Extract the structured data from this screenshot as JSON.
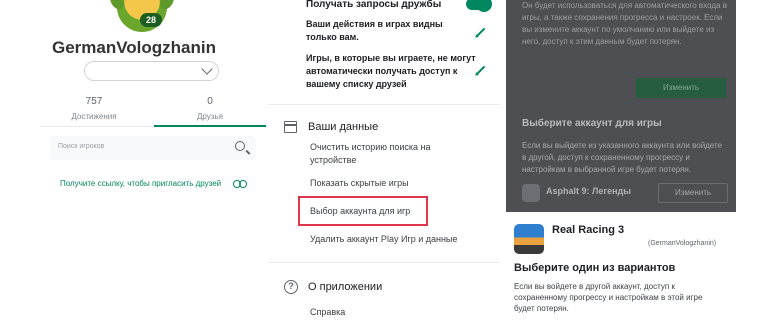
{
  "profile": {
    "level": "28",
    "username": "GermanVologzhanin",
    "stats": {
      "achievements_value": "757",
      "achievements_label": "Достижения",
      "friends_value": "0",
      "friends_label": "Друзья"
    },
    "search_placeholder": "Поиск игроков",
    "invite_text": "Получите ссылку, чтобы пригласить друзей"
  },
  "settings": {
    "friend_requests_title": "Получать запросы дружбы",
    "game_activity_text": "Ваши действия в играх видны только вам.",
    "friends_access_text": "Игры, в которые вы играете, не могут автоматически получать доступ к вашему списку друзей",
    "your_data_header": "Ваши данные",
    "clear_history": "Очистить историю поиска на устройстве",
    "show_hidden": "Показать скрытые игры",
    "choose_account": "Выбор аккаунта для игр",
    "delete_account": "Удалить аккаунт Play Игр и данные",
    "about_header": "О приложении",
    "help": "Справка"
  },
  "dialog": {
    "top_text": "Он будет использоваться для автоматического входа в игры, а также сохранения прогресса и настроек. Если вы измените аккаунт по умолчанию или выйдете из него, доступ к этим данным будет потерян.",
    "change_button_1": "Изменить",
    "choose_game_account_title": "Выберите аккаунт для игры",
    "choose_game_account_desc": "Если вы выйдете из указанного аккаунта или войдете в другой, доступ к сохраненному прогрессу и настройкам в выбранной игре будет потерян.",
    "game_name": "Asphalt 9: Легенды",
    "change_button_2": "Изменить"
  },
  "card": {
    "game_title": "Real Racing 3",
    "account_label": "(GermanVologzhanin)",
    "choose_option_title": "Выберите один из вариантов",
    "choose_option_desc": "Если вы войдете в другой аккаунт, доступ к сохраненному прогрессу и настройкам в этой игре будет потерян."
  },
  "colors": {
    "accent": "#01875f",
    "highlight": "#e0364b",
    "overlay": "#4d4f52"
  }
}
